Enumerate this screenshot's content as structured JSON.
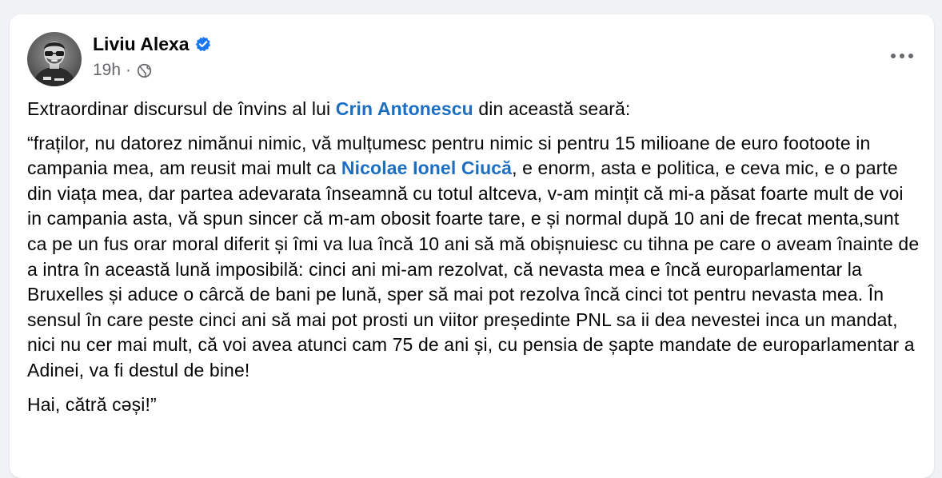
{
  "post": {
    "author": {
      "name": "Liviu Alexa",
      "verified": true,
      "avatar_icon": "profile-photo-icon"
    },
    "timestamp": "19h",
    "separator": "·",
    "audience_icon": "globe-icon",
    "more_icon": "more-options-icon",
    "paragraph_1": {
      "before_mention": "Extraordinar discursul de învins al lui ",
      "mention": "Crin Antonescu",
      "after_mention": " din această seară:"
    },
    "paragraph_2": {
      "before_mention": "“fraților, nu datorez nimănui nimic, vă mulțumesc pentru nimic si pentru 15 milioane de euro footoote in campania mea, am reusit mai mult ca ",
      "mention": "Nicolae Ionel Ciucă",
      "after_mention": ", e enorm, asta e politica, e ceva mic, e o parte din viața mea, dar partea adevarata înseamnă cu totul altceva, v-am mințit că mi-a păsat foarte mult de voi in campania asta, vă spun sincer că m-am obosit foarte tare, e și normal după 10 ani de frecat menta,sunt ca pe un fus orar moral diferit și îmi va lua încă 10 ani să mă obișnuiesc cu tihna pe care o aveam înainte de a intra în această lună imposibilă: cinci ani mi-am rezolvat, că nevasta mea e încă europarlamentar la Bruxelles și aduce o cârcă de bani pe lună, sper să mai pot rezolva încă cinci tot pentru nevasta mea. În sensul în care peste cinci ani să mai pot prosti un viitor președinte PNL sa ii dea nevestei inca un mandat, nici nu cer mai mult, că voi avea atunci cam 75 de ani și, cu pensia de șapte mandate de europarlamentar a Adinei, va fi destul de bine!"
    },
    "paragraph_3": "Hai, cătră cәși!”"
  },
  "colors": {
    "link": "#1b6ec2",
    "verified_badge": "#1877f2",
    "text": "#050505",
    "secondary_text": "#65676b",
    "page_background": "#f0f2f5"
  }
}
